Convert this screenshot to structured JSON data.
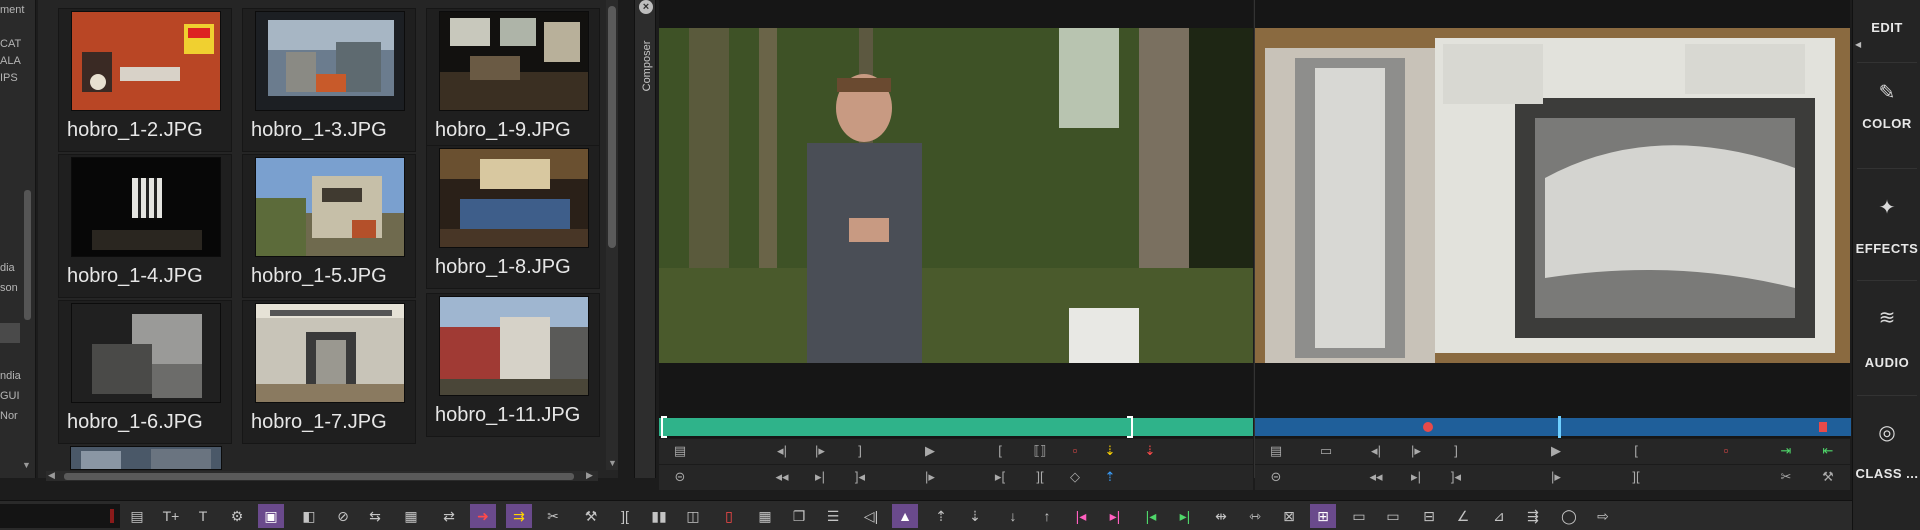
{
  "left_strip": {
    "lines": [
      "ment",
      "CAT",
      "ALA",
      "IPS",
      "dia",
      "son",
      "ndia",
      "GUI",
      "Nor"
    ]
  },
  "bin": {
    "items": [
      {
        "label": "hobro_1-2.JPG"
      },
      {
        "label": "hobro_1-3.JPG"
      },
      {
        "label": "hobro_1-9.JPG"
      },
      {
        "label": "hobro_1-4.JPG"
      },
      {
        "label": "hobro_1-5.JPG"
      },
      {
        "label": "hobro_1-8.JPG"
      },
      {
        "label": "hobro_1-6.JPG"
      },
      {
        "label": "hobro_1-7.JPG"
      },
      {
        "label": "hobro_1-11.JPG"
      }
    ]
  },
  "composer": {
    "label": "Composer",
    "close_icon": "close-icon"
  },
  "colors": {
    "source_bar": "#2fb38a",
    "record_bar": "#1f5f9a",
    "accent_purple": "#6a4a8c"
  },
  "right_bar": {
    "items": [
      {
        "label": "EDIT",
        "icon": "edit-icon"
      },
      {
        "label": "COLOR",
        "icon": "eyedropper-icon"
      },
      {
        "label": "EFFECTS",
        "icon": "magic-wand-icon"
      },
      {
        "label": "AUDIO",
        "icon": "waveform-icon"
      },
      {
        "label": "CLASS ...",
        "icon": "camera-shutter-icon"
      }
    ]
  }
}
